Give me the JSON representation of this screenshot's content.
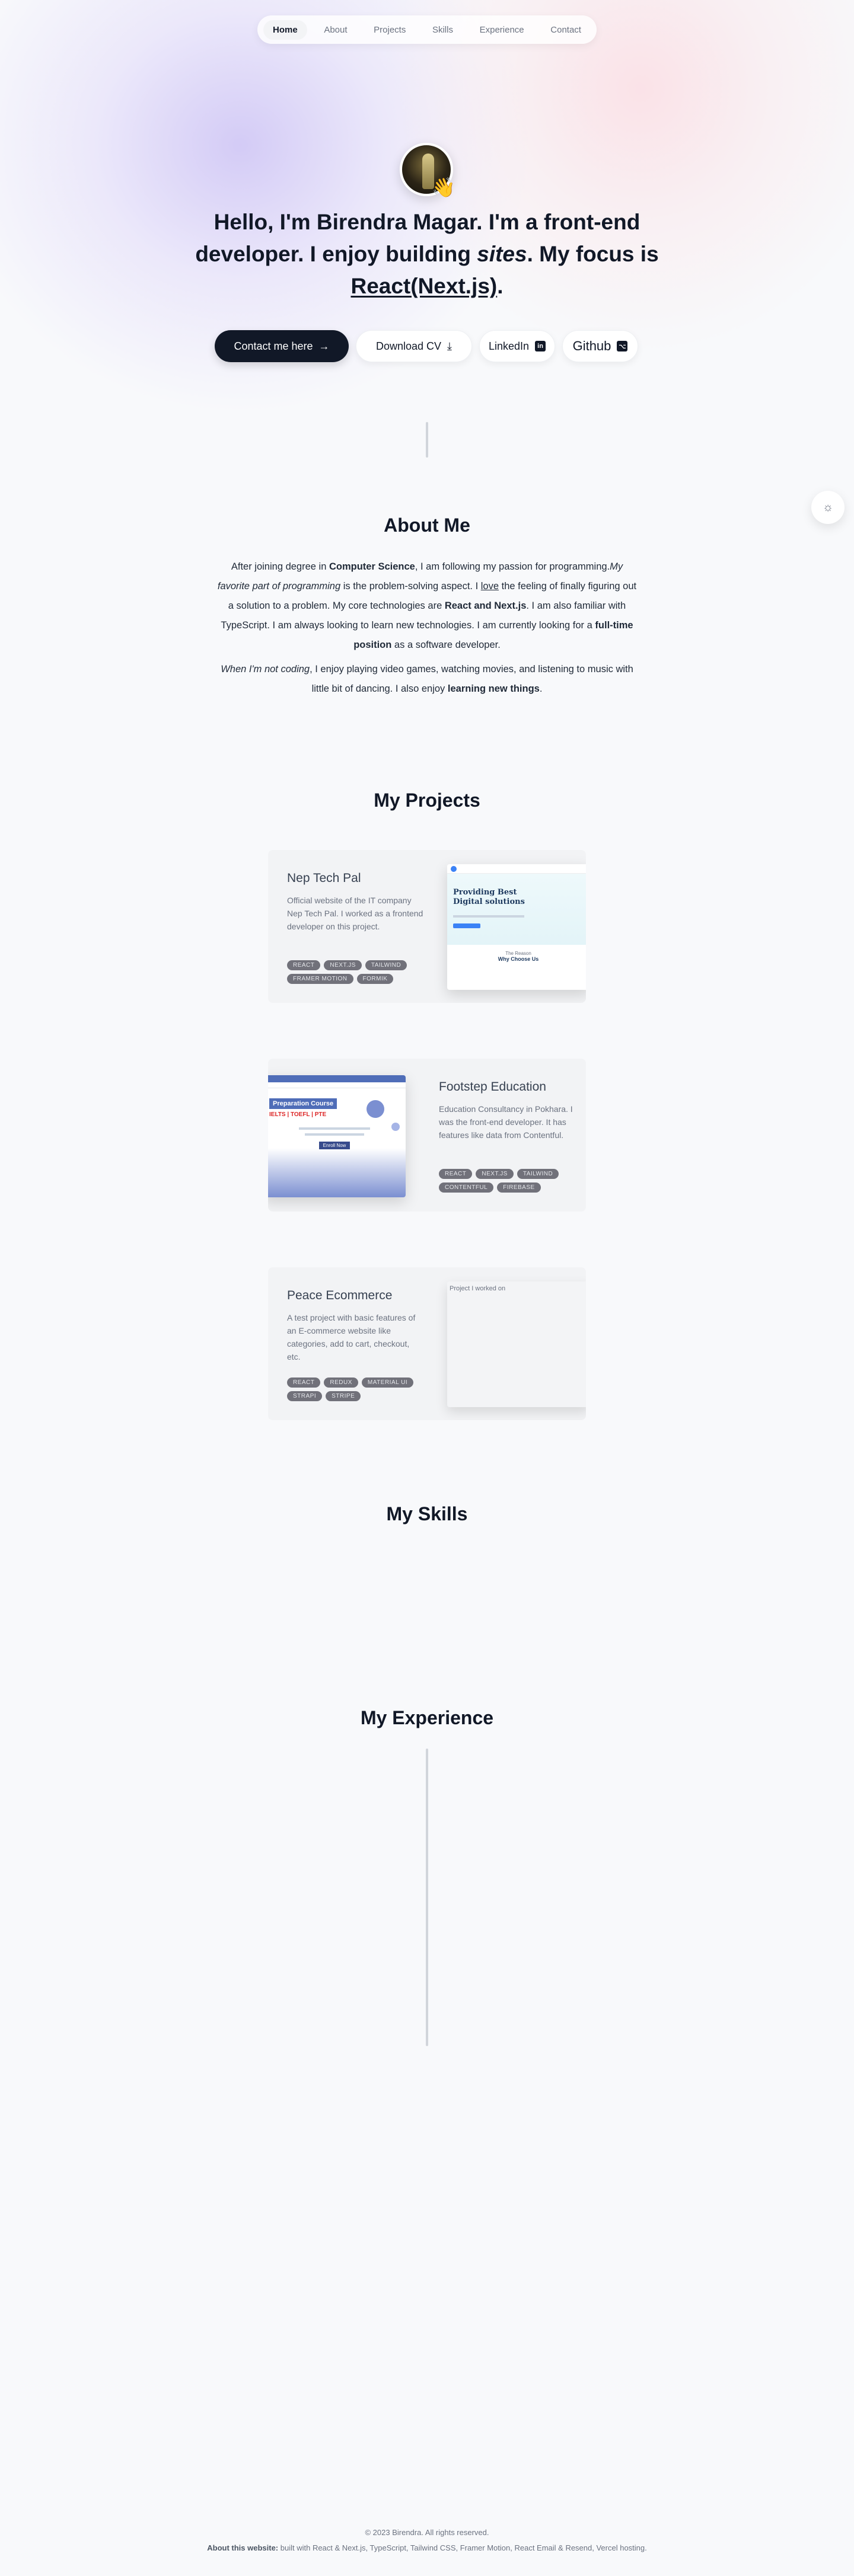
{
  "nav": {
    "items": [
      {
        "label": "Home",
        "active": true
      },
      {
        "label": "About"
      },
      {
        "label": "Projects"
      },
      {
        "label": "Skills"
      },
      {
        "label": "Experience"
      },
      {
        "label": "Contact"
      }
    ]
  },
  "hero": {
    "greeting": "Hello, I'm Birendra Magar.",
    "im_a": " I'm a ",
    "role": "front-end developer.",
    "enjoy": " I enjoy building ",
    "sites": "sites",
    "focus": ". My focus is ",
    "stack": "React(Next.js)",
    "end": ".",
    "wave_icon": "👋"
  },
  "buttons": {
    "contact": "Contact me here",
    "contact_icon": "→",
    "cv": "Download CV",
    "cv_icon": "⤓",
    "linkedin": "LinkedIn",
    "linkedin_icon": "in",
    "github": "Github",
    "github_icon": "⌥"
  },
  "about": {
    "title": "About Me",
    "p1_a": "After joining degree in ",
    "p1_b": "Computer Science",
    "p1_c": ", I am following my passion for programming.",
    "p1_d": "My favorite part of programming",
    "p1_e": " is the problem-solving aspect. I ",
    "p1_f": "love",
    "p1_g": " the feeling of finally figuring out a solution to a problem. My core technologies are ",
    "p1_h": "React and Next.js",
    "p1_i": ". I am also familiar with TypeScript. I am always looking to learn new technologies. I am currently looking for a ",
    "p1_j": "full-time position",
    "p1_k": " as a software developer.",
    "p2_a": "When I'm not coding",
    "p2_b": ", I enjoy playing video games, watching movies, and listening to music with little bit of dancing. I also enjoy ",
    "p2_c": "learning new things",
    "p2_d": "."
  },
  "projects": {
    "title": "My Projects",
    "items": [
      {
        "title": "Nep Tech Pal",
        "desc": "Official website of the IT company Nep Tech Pal. I worked as a frontend developer on this project.",
        "tags": [
          "REACT",
          "NEXT.JS",
          "TAILWIND",
          "FRAMER MOTION",
          "FORMIK"
        ],
        "shot": {
          "hero": "Providing Best Digital solutions",
          "sub": "The Reason",
          "sub2": "Why Choose Us"
        }
      },
      {
        "title": "Footstep Education",
        "desc": "Education Consultancy in Pokhara. I was the front-end developer. It has features like data from Contentful.",
        "tags": [
          "REACT",
          "NEXT.JS",
          "TAILWIND",
          "CONTENTFUL",
          "FIREBASE"
        ],
        "shot": {
          "hero": "Preparation Course",
          "line": "IELTS | TOEFL | PTE",
          "cta": "Enroll Now"
        }
      },
      {
        "title": "Peace Ecommerce",
        "desc": "A test project with basic features of an E-commerce website like categories, add to cart, checkout, etc.",
        "tags": [
          "REACT",
          "REDUX",
          "MATERIAL UI",
          "STRAPI",
          "STRIPE"
        ],
        "shot": {
          "alt": "Project I worked on"
        }
      }
    ]
  },
  "skills": {
    "title": "My Skills"
  },
  "experience": {
    "title": "My Experience"
  },
  "settings": {
    "icon": "sun-icon",
    "glyph": "☼"
  },
  "footer": {
    "copyright": "© 2023 Birendra. All rights reserved.",
    "about_label": "About this website:",
    "about_text": " built with React & Next.js, TypeScript, Tailwind CSS, Framer Motion, React Email & Resend, Vercel hosting."
  }
}
